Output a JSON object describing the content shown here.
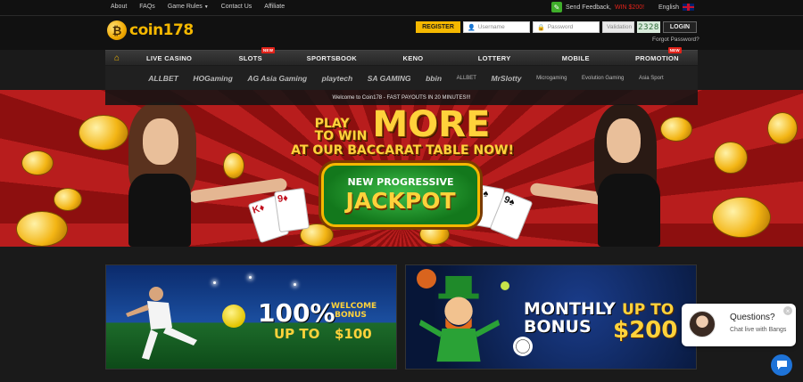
{
  "topbar": {
    "links": [
      "About",
      "FAQs",
      "Game Rules",
      "Contact Us",
      "Affiliate"
    ],
    "feedback_label": "Send Feedback,",
    "feedback_win": "WIN $200!",
    "language": "English"
  },
  "header": {
    "logo_text": "coin178",
    "register_label": "REGISTER",
    "username_placeholder": "Username",
    "password_placeholder": "Password",
    "validation_placeholder": "Validation",
    "captcha_code": "2328",
    "login_label": "LOGIN",
    "forgot_label": "Forgot Password?"
  },
  "nav": {
    "items": [
      {
        "label": "LIVE CASINO",
        "new": false
      },
      {
        "label": "SLOTS",
        "new": true
      },
      {
        "label": "SPORTSBOOK",
        "new": false
      },
      {
        "label": "KENO",
        "new": false
      },
      {
        "label": "LOTTERY",
        "new": false
      },
      {
        "label": "MOBILE",
        "new": false
      },
      {
        "label": "PROMOTION",
        "new": true
      }
    ],
    "new_badge": "NEW"
  },
  "providers": [
    "ALLBET",
    "HOGaming",
    "AG Asia Gaming",
    "playtech",
    "SA GAMING",
    "bbin",
    "ALLBET",
    "MrSlotty",
    "Microgaming",
    "Evolution Gaming",
    "Asia Sport"
  ],
  "banner": {
    "marquee": "Welcome to Coin178 - FAST PAYOUTS IN 20 MINUTES!!!",
    "line_small_1": "PLAY",
    "line_small_2": "TO WIN",
    "line_big": "MORE",
    "line_2": "AT OUR BACCARAT TABLE NOW!",
    "jackpot_top": "NEW PROGRESSIVE",
    "jackpot_main": "JACKPOT",
    "slide_count": 5,
    "active_slide": 1
  },
  "promos": {
    "left": {
      "pct": "100%",
      "upto": "UP TO",
      "label": "WELCOME BONUS",
      "amount": "$100"
    },
    "right": {
      "title_1": "MONTHLY",
      "title_2": "BONUS",
      "upto": "UP TO",
      "amount": "$200"
    }
  },
  "chat": {
    "title": "Questions?",
    "subtitle": "Chat live with Bangs"
  },
  "colors": {
    "accent": "#f5b800",
    "badge": "#e2231a",
    "chat_button": "#1e73d8"
  }
}
